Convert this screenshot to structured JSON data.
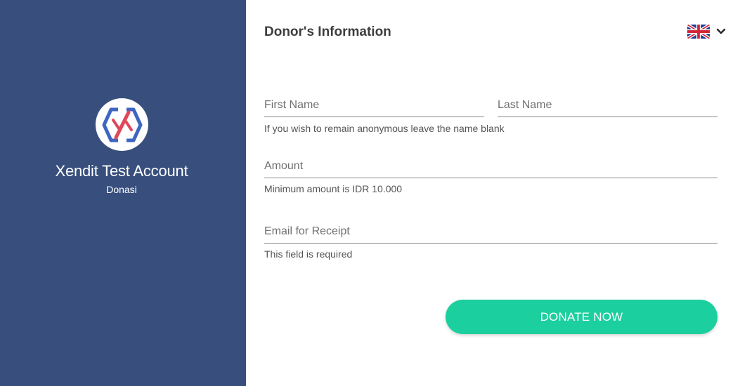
{
  "brand": {
    "account_name": "Xendit Test Account",
    "page_type": "Donasi",
    "logo_icon": "xendit-logo-icon"
  },
  "form": {
    "heading": "Donor's Information",
    "language": {
      "flag_icon": "uk-flag-icon",
      "dropdown_icon": "chevron-down-icon"
    },
    "first_name": {
      "placeholder": "First Name",
      "value": ""
    },
    "last_name": {
      "placeholder": "Last Name",
      "value": ""
    },
    "name_hint": "If you wish to remain anonymous leave the name blank",
    "amount": {
      "placeholder": "Amount",
      "value": ""
    },
    "amount_hint": "Minimum amount is IDR 10.000",
    "email": {
      "placeholder": "Email for Receipt",
      "value": ""
    },
    "email_hint": "This field is required",
    "submit_label": "DONATE NOW"
  },
  "colors": {
    "sidebar": "#384f7d",
    "accent": "#1ccf9e",
    "logo_blue": "#3d66c2",
    "logo_red": "#e0475a"
  }
}
